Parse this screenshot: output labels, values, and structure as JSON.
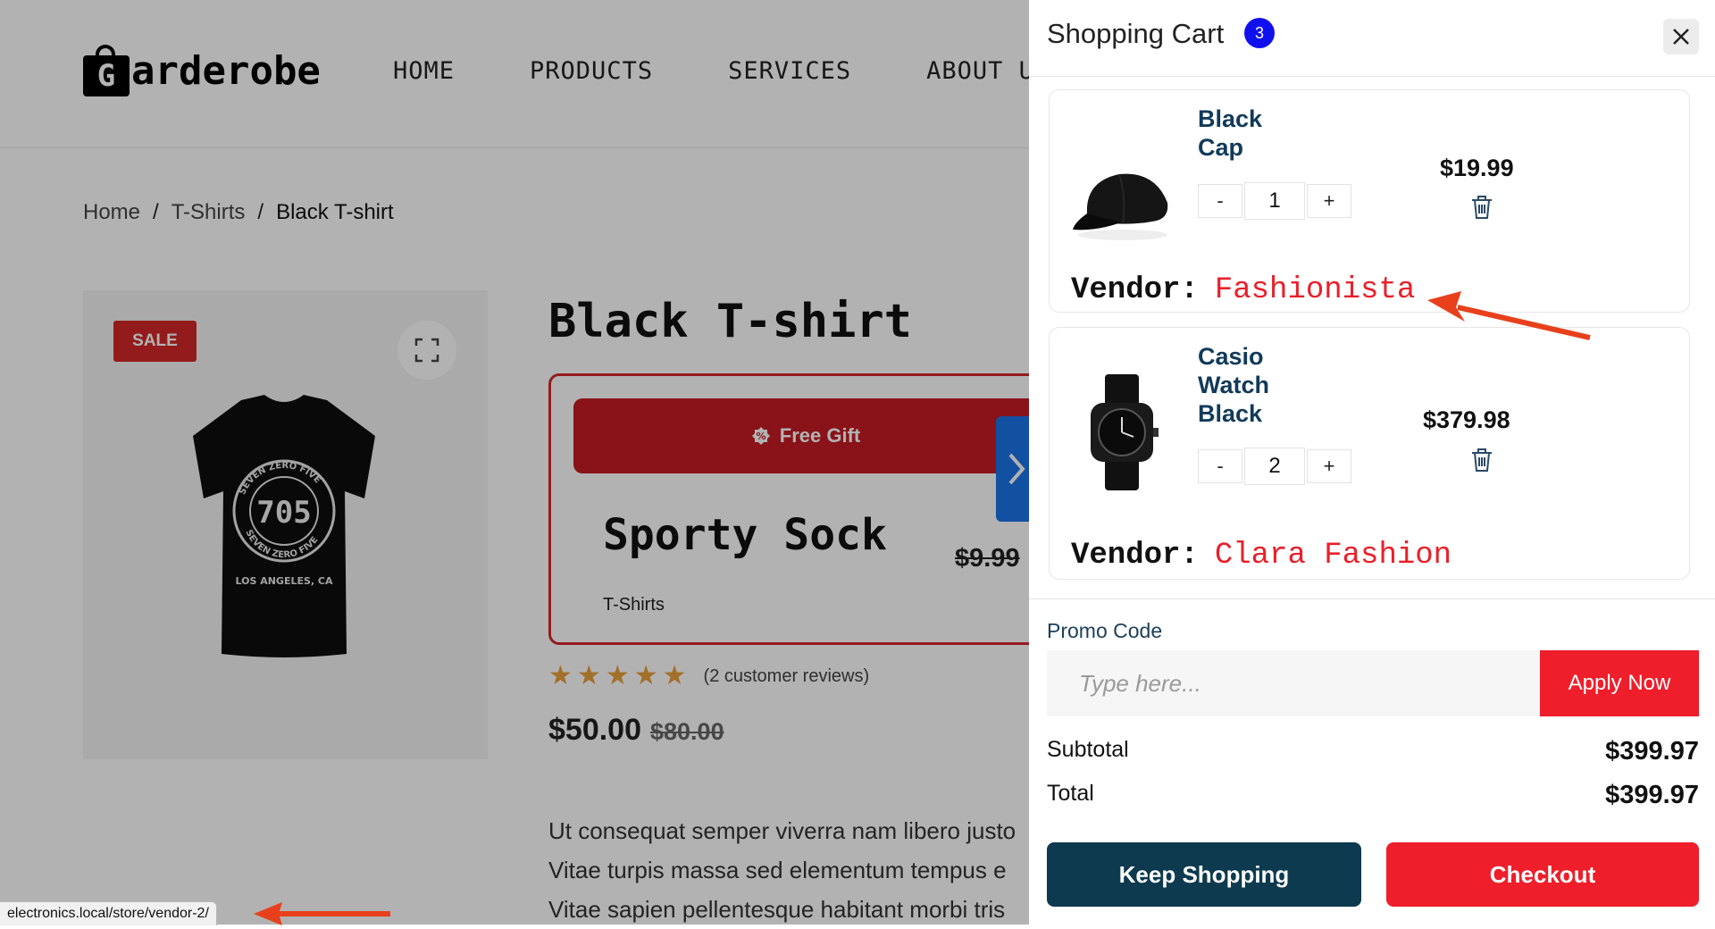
{
  "store": {
    "logo_letter": "G",
    "logo_word": "arderobe",
    "nav": [
      "HOME",
      "PRODUCTS",
      "SERVICES",
      "ABOUT US"
    ],
    "breadcrumb": {
      "home": "Home",
      "category": "T-Shirts",
      "current": "Black T-shirt"
    },
    "sale_badge": "SALE",
    "product_title": "Black T-shirt",
    "tshirt_print": {
      "number": "705",
      "ring": "SEVEN ZERO FIVE",
      "location": "LOS ANGELES, CA"
    },
    "gift": {
      "button_label": "Free Gift",
      "name": "Sporty Sock",
      "old_price": "$9.99",
      "category": "T-Shirts"
    },
    "rating": {
      "stars": 5,
      "reviews": "(2 customer reviews)"
    },
    "price": "$50.00",
    "old_price": "$80.00",
    "description_lines": [
      "Ut consequat semper viverra nam libero justo",
      "Vitae turpis massa sed elementum tempus e",
      "Vitae sapien pellentesque habitant morbi tris"
    ]
  },
  "status_url": "electronics.local/store/vendor-2/",
  "cart": {
    "title": "Shopping Cart",
    "count": "3",
    "items": [
      {
        "name": "Black Cap",
        "qty": "1",
        "price": "$19.99",
        "vendor_label": "Vendor:",
        "vendor_name": "Fashionista"
      },
      {
        "name": "Casio Watch Black",
        "qty": "2",
        "price": "$379.98",
        "vendor_label": "Vendor:",
        "vendor_name": "Clara Fashion"
      }
    ],
    "qty_minus": "-",
    "qty_plus": "+",
    "promo_label": "Promo Code",
    "promo_placeholder": "Type here...",
    "apply_label": "Apply Now",
    "subtotal_label": "Subtotal",
    "subtotal_value": "$399.97",
    "total_label": "Total",
    "total_value": "$399.97",
    "keep_shopping": "Keep Shopping",
    "checkout": "Checkout"
  },
  "colors": {
    "accent_red": "#ee1e2a",
    "navy": "#0d3a4f",
    "count_badge": "#1010ee",
    "annotation_arrow": "#e8401c"
  }
}
